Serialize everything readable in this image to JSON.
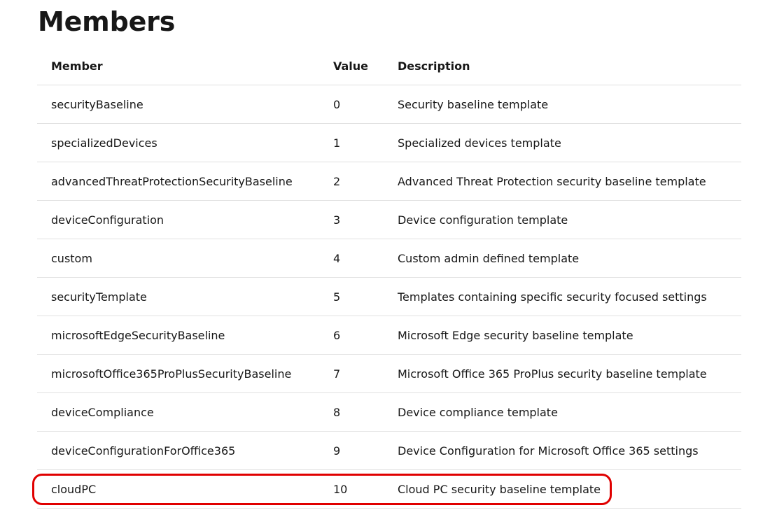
{
  "page": {
    "title": "Members"
  },
  "table": {
    "headers": {
      "member": "Member",
      "value": "Value",
      "description": "Description"
    },
    "rows": [
      {
        "member": "securityBaseline",
        "value": "0",
        "description": "Security baseline template"
      },
      {
        "member": "specializedDevices",
        "value": "1",
        "description": "Specialized devices template"
      },
      {
        "member": "advancedThreatProtectionSecurityBaseline",
        "value": "2",
        "description": "Advanced Threat Protection security baseline template"
      },
      {
        "member": "deviceConfiguration",
        "value": "3",
        "description": "Device configuration template"
      },
      {
        "member": "custom",
        "value": "4",
        "description": "Custom admin defined template"
      },
      {
        "member": "securityTemplate",
        "value": "5",
        "description": "Templates containing specific security focused settings"
      },
      {
        "member": "microsoftEdgeSecurityBaseline",
        "value": "6",
        "description": "Microsoft Edge security baseline template"
      },
      {
        "member": "microsoftOffice365ProPlusSecurityBaseline",
        "value": "7",
        "description": "Microsoft Office 365 ProPlus security baseline template"
      },
      {
        "member": "deviceCompliance",
        "value": "8",
        "description": "Device compliance template"
      },
      {
        "member": "deviceConfigurationForOffice365",
        "value": "9",
        "description": "Device Configuration for Microsoft Office 365 settings"
      },
      {
        "member": "cloudPC",
        "value": "10",
        "description": "Cloud PC security baseline template"
      }
    ]
  },
  "annotation": {
    "highlight_color": "#e00000",
    "highlighted_row": "cloudPC"
  }
}
